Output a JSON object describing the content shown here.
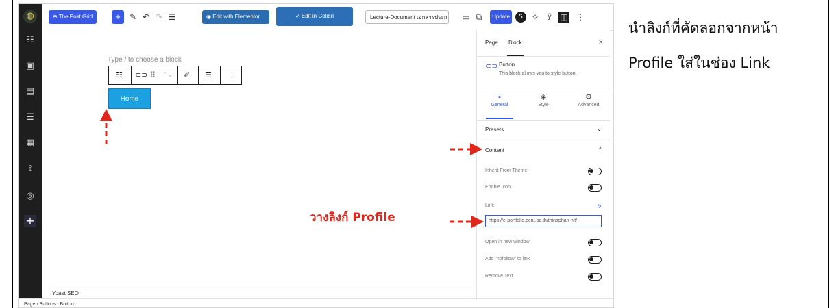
{
  "caption": {
    "line1": "นำลิงก์ที่คัดลอกจากหน้า",
    "line2": "Profile ใส่ในช่อง  Link"
  },
  "toolbar": {
    "post_grid_label": "The Post Grid",
    "edit_elementor_label": "Edit with Elementor",
    "edit_colibri_label": "Edit in Colibri",
    "document_title": "Lecture-Document เอกสารประก",
    "update_label": "Update"
  },
  "canvas": {
    "placeholder": "Type / to choose a block",
    "home_button": "Home",
    "yoast_label": "Yoast SEO"
  },
  "sidebar": {
    "tab_page": "Page",
    "tab_block": "Block",
    "close_glyph": "×",
    "block_title": "Button",
    "block_desc": "This block allows you to style button.",
    "tab_general": "General",
    "tab_style": "Style",
    "tab_advanced": "Advanced",
    "presets": "Presets",
    "content": "Content",
    "inherit_theme": "Inherit From Theme",
    "enable_icon": "Enable Icon",
    "link_label": "Link",
    "link_value": "https://e-portfolio.pcru.ac.th/thinaphan-nit/",
    "open_new_window": "Open in new window",
    "nofollow": "Add \"nofollow\" to link",
    "remove_text": "Remove Text",
    "chev_down": "⌄",
    "chev_up": "^"
  },
  "annotation": {
    "paste_profile": "วางลิงก์ Profile"
  },
  "breadcrumb": {
    "text": "Page  ›  Buttons  ›  Button"
  },
  "colors": {
    "accent": "#3858e9",
    "home_button": "#1ba1e2",
    "annotation": "#e0271c",
    "admin_bar": "#1e1e1e"
  }
}
